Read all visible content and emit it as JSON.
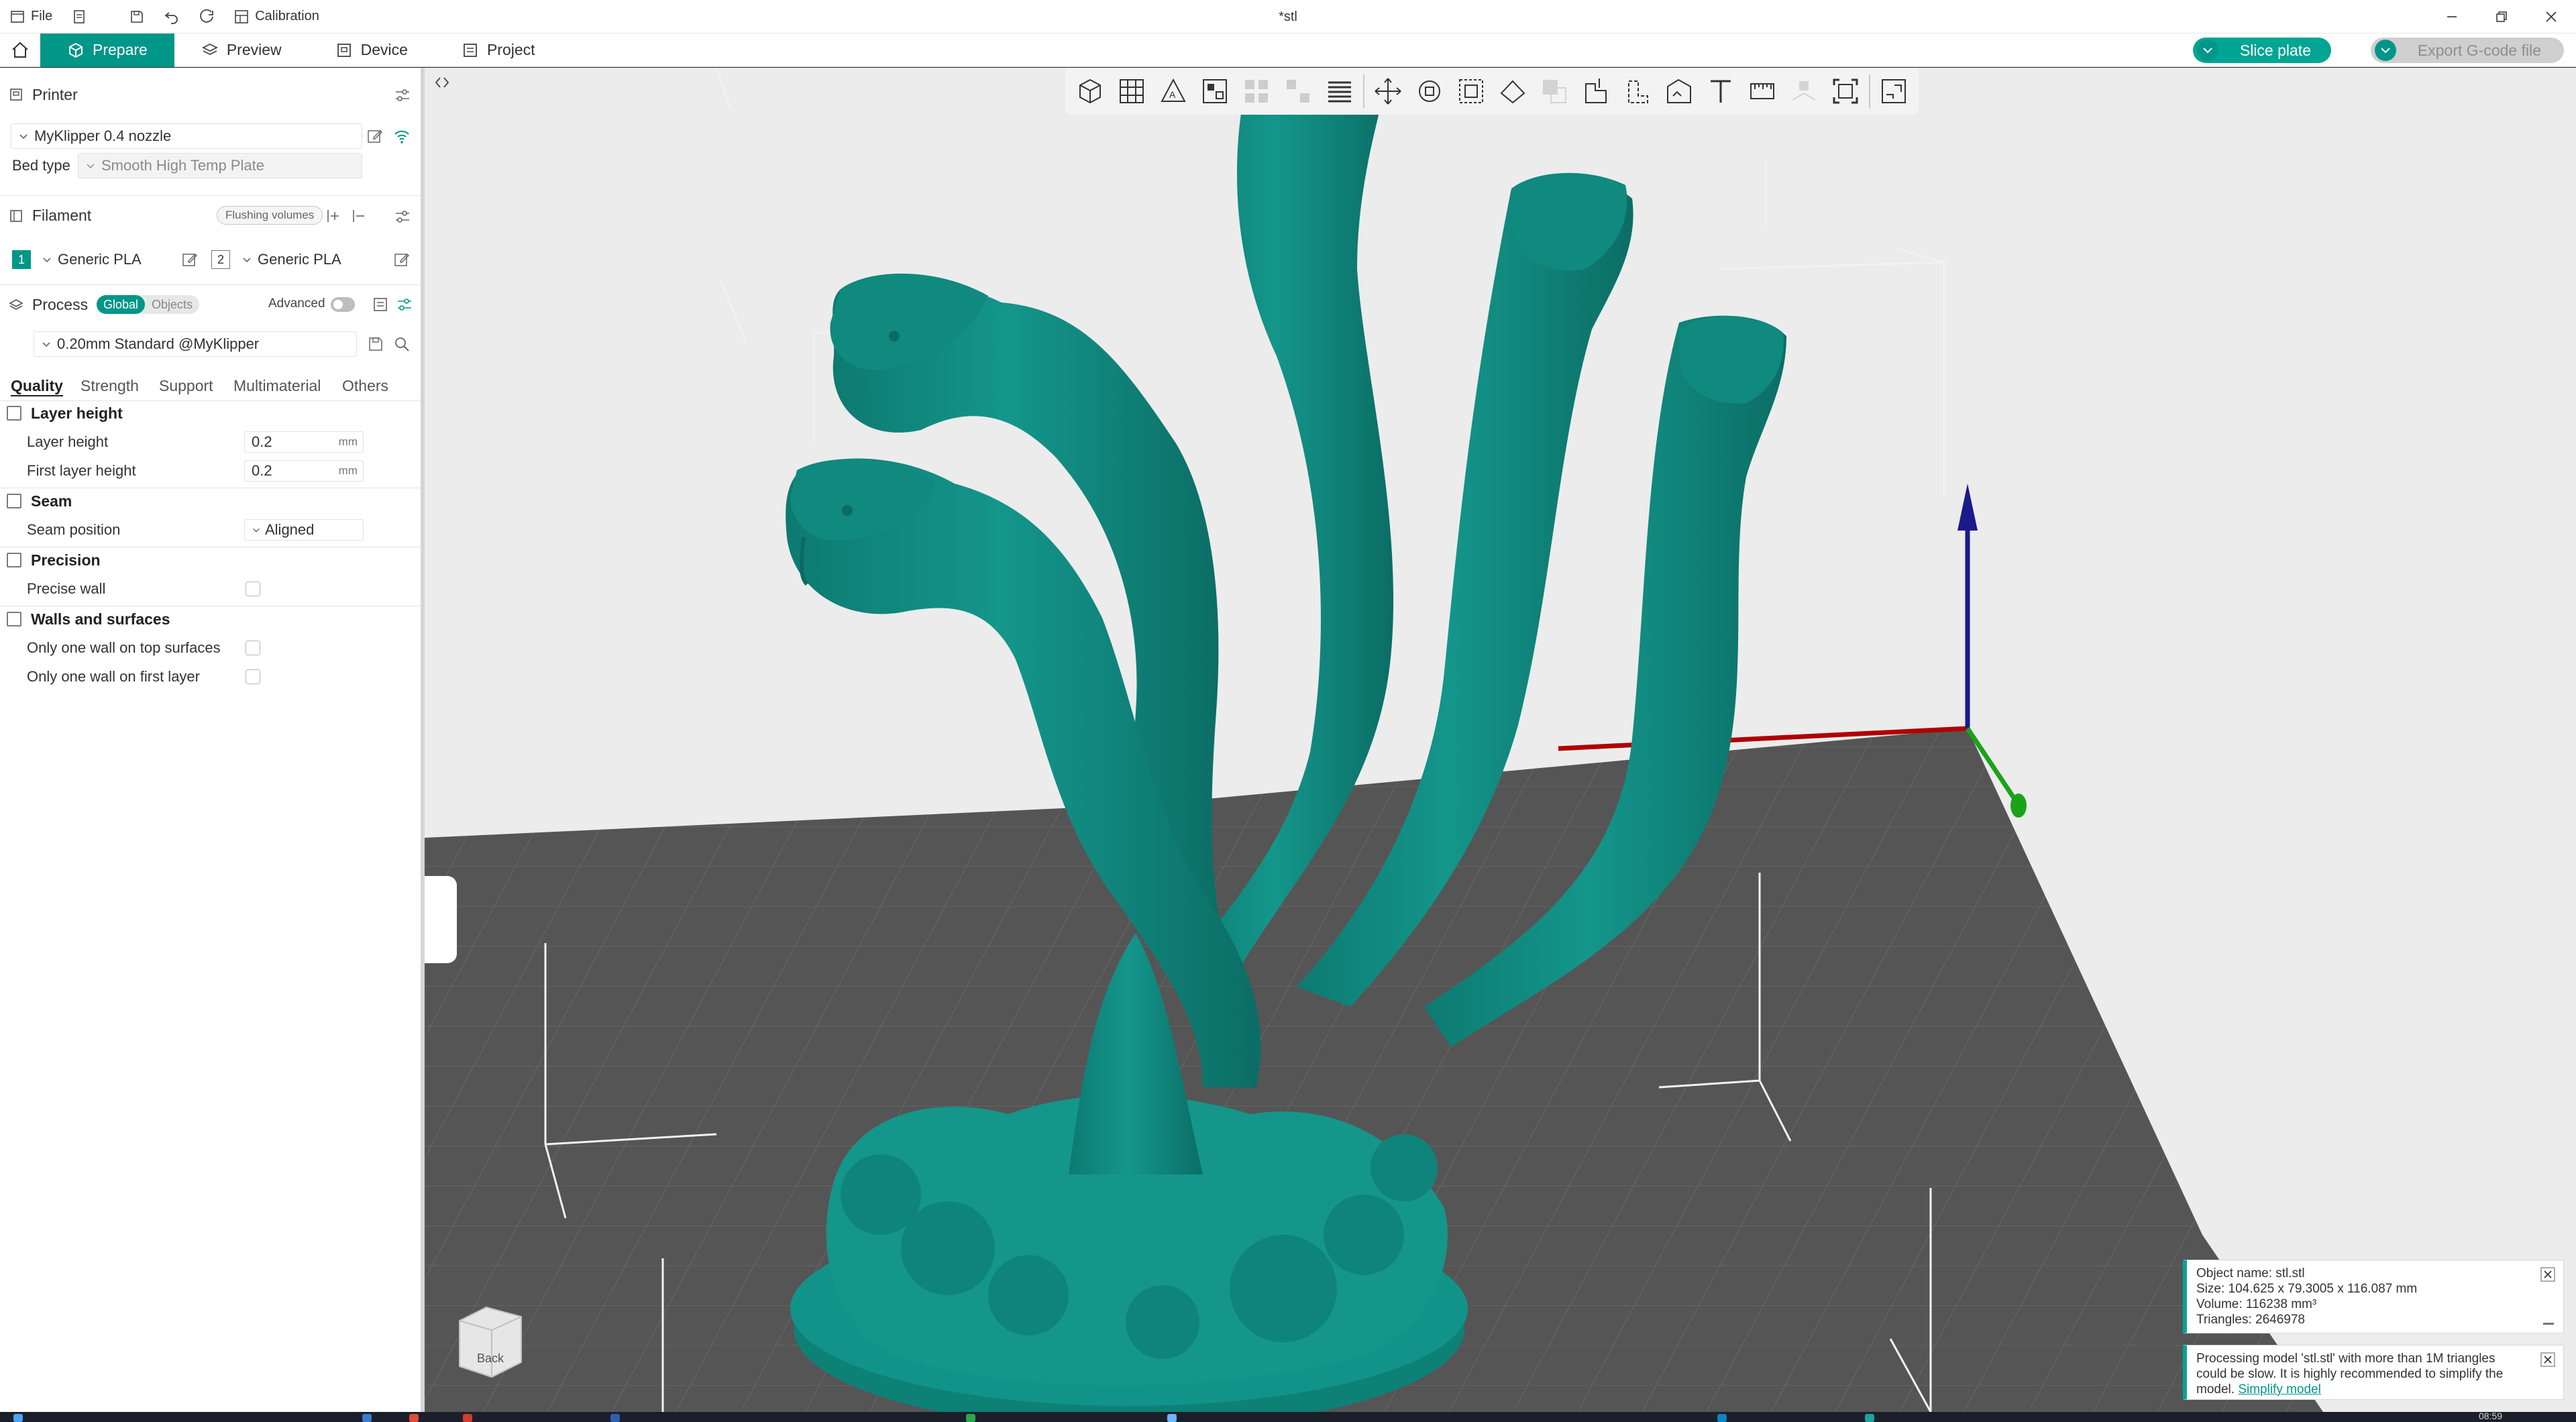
{
  "titlebar": {
    "file_label": "File",
    "calibration_label": "Calibration",
    "doc_title": "*stl"
  },
  "tabs": {
    "prepare": "Prepare",
    "preview": "Preview",
    "device": "Device",
    "project": "Project"
  },
  "actions": {
    "slice_plate": "Slice plate",
    "export_gcode": "Export G-code file"
  },
  "printer": {
    "section_label": "Printer",
    "name": "MyKlipper 0.4 nozzle",
    "bed_type_label": "Bed type",
    "bed_type_value": "Smooth High Temp Plate"
  },
  "filament": {
    "section_label": "Filament",
    "flushing_volumes": "Flushing volumes",
    "slots": [
      {
        "index": "1",
        "name": "Generic PLA"
      },
      {
        "index": "2",
        "name": "Generic PLA"
      }
    ]
  },
  "process": {
    "section_label": "Process",
    "global_label": "Global",
    "objects_label": "Objects",
    "advanced_label": "Advanced",
    "profile": "0.20mm Standard @MyKlipper",
    "tabs": [
      "Quality",
      "Strength",
      "Support",
      "Multimaterial",
      "Others"
    ]
  },
  "settings": {
    "layer_height_group": "Layer height",
    "layer_height_label": "Layer height",
    "layer_height_value": "0.2",
    "first_layer_height_label": "First layer height",
    "first_layer_height_value": "0.2",
    "unit_mm": "mm",
    "seam_group": "Seam",
    "seam_position_label": "Seam position",
    "seam_position_value": "Aligned",
    "precision_group": "Precision",
    "precise_wall_label": "Precise wall",
    "walls_group": "Walls and surfaces",
    "one_wall_top_label": "Only one wall on top surfaces",
    "one_wall_first_label": "Only one wall on first layer"
  },
  "viewport": {
    "view_cube_label": "Back",
    "colors": {
      "model": "#118a80",
      "plate": "#555555",
      "accent": "#009688"
    }
  },
  "object_info": {
    "name": "Object name: stl.stl",
    "size": "Size: 104.625 x 79.3005 x 116.087 mm",
    "volume": "Volume: 116238 mm³",
    "triangles": "Triangles: 2646978"
  },
  "warning": {
    "text": "Processing model 'stl.stl' with more than 1M triangles could be slow. It is highly recommended to simplify the model.",
    "link": "Simplify model"
  },
  "taskbar": {
    "clock": "08:59"
  }
}
